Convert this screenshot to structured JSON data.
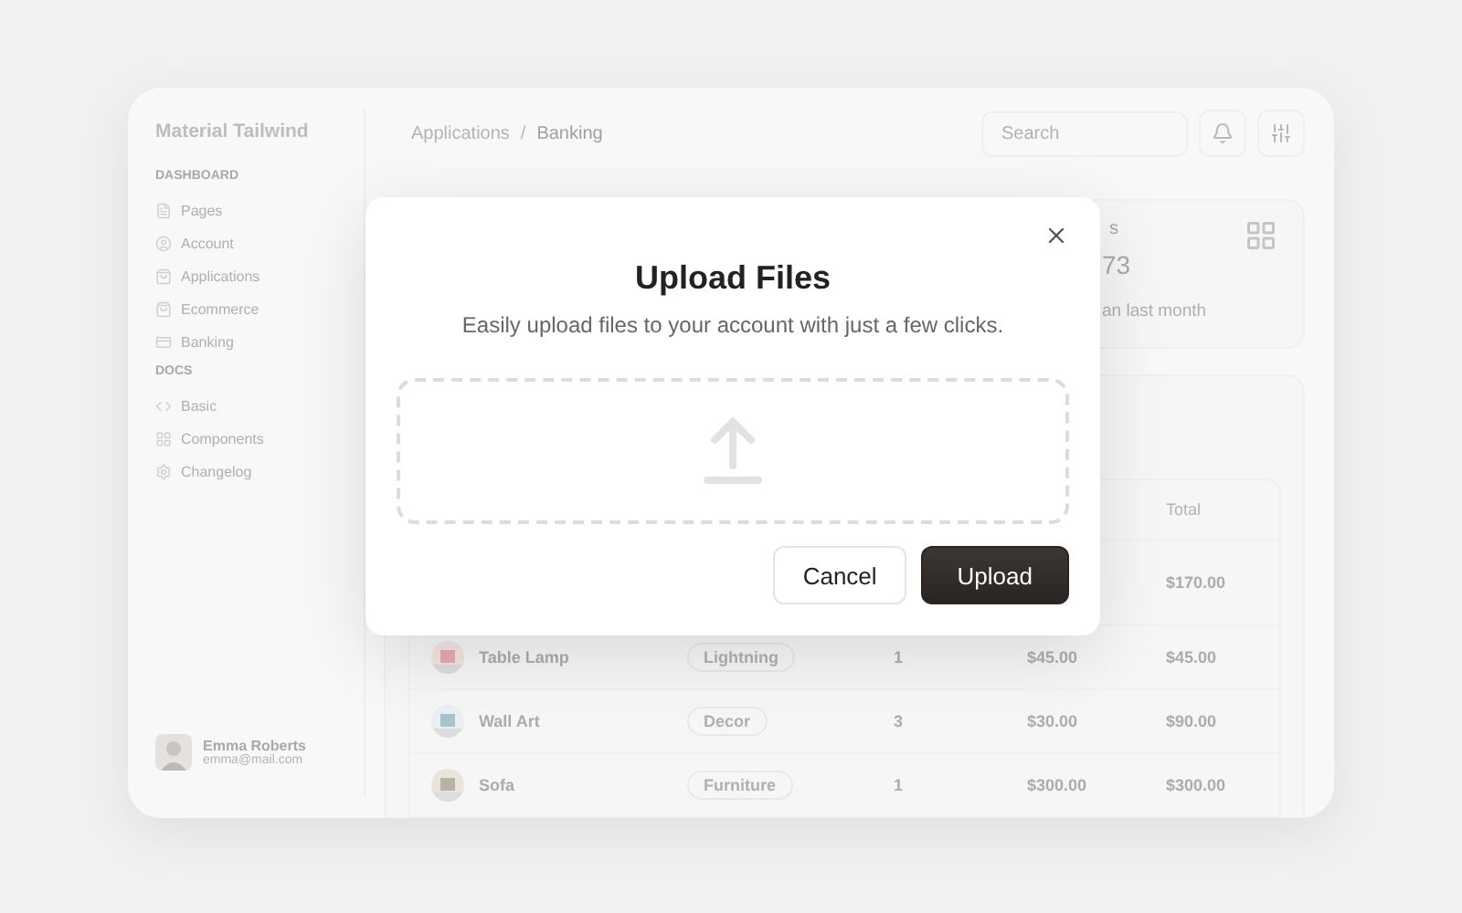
{
  "sidebar": {
    "brand": "Material Tailwind",
    "sections": [
      {
        "heading": "DASHBOARD",
        "items": [
          {
            "label": "Pages",
            "selected": false
          },
          {
            "label": "Account",
            "selected": false
          },
          {
            "label": "Applications",
            "selected": false
          },
          {
            "label": "Ecommerce",
            "selected": false
          },
          {
            "label": "Banking",
            "selected": false
          }
        ]
      },
      {
        "heading": "DOCS",
        "items": [
          {
            "label": "Basic",
            "selected": false
          },
          {
            "label": "Components",
            "selected": false
          },
          {
            "label": "Changelog",
            "selected": false
          }
        ]
      }
    ],
    "user": {
      "name": "Emma Roberts",
      "email": "emma@mail.com"
    }
  },
  "header": {
    "breadcrumb": [
      "Applications",
      "Banking"
    ],
    "separator": "/",
    "search": {
      "placeholder": "Search"
    }
  },
  "stat_card": {
    "label": "s",
    "value": "73",
    "note": "an last month"
  },
  "table": {
    "columns": [
      "Total"
    ],
    "rows": [
      {
        "total": "$170.00"
      },
      {
        "product": "Table Lamp",
        "category": "Lightning",
        "qty": "1",
        "price": "$45.00",
        "total": "$45.00"
      },
      {
        "product": "Wall Art",
        "category": "Decor",
        "qty": "3",
        "price": "$30.00",
        "total": "$90.00"
      },
      {
        "product": "Sofa",
        "category": "Furniture",
        "qty": "1",
        "price": "$300.00",
        "total": "$300.00"
      }
    ]
  },
  "modal": {
    "title": "Upload Files",
    "subtitle": "Easily upload files to your account with just a few clicks.",
    "buttons": [
      {
        "label": "Cancel",
        "kind": "secondary"
      },
      {
        "label": "Upload",
        "kind": "primary"
      }
    ]
  }
}
